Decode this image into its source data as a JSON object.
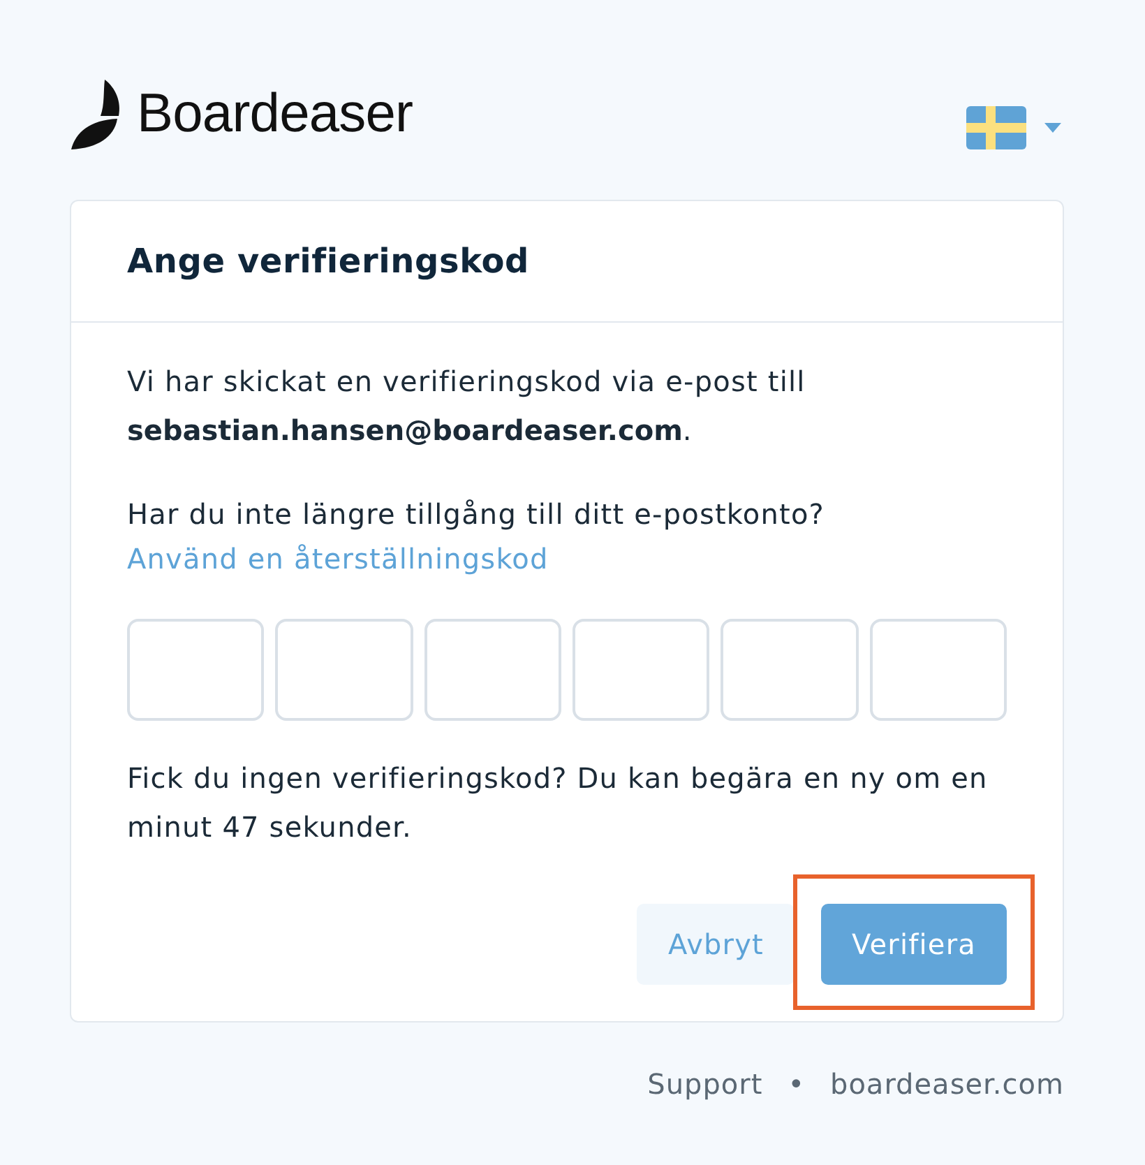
{
  "header": {
    "logo_text": "Boardeaser"
  },
  "card": {
    "title": "Ange verifieringskod",
    "message": "Vi har skickat en verifieringskod via e-post till **sebastian.hansen@boardeaser.com**.",
    "question": "Har du inte längre tillgång till ditt e-postkonto?",
    "recovery_link": "Använd en återställningskod",
    "code_fields": [
      {
        "focused": false
      },
      {
        "focused": false
      },
      {
        "focused": false
      },
      {
        "focused": false
      },
      {
        "focused": false
      },
      {
        "focused": false
      }
    ],
    "resend_notice": "Fick du ingen verifieringskod? Du kan begära en ny om en minut 47 sekunder.",
    "buttons": [
      {
        "label": "Avbryt",
        "kind": "secondary",
        "highlighted": false
      },
      {
        "label": "Verifiera",
        "kind": "primary",
        "highlighted": true
      }
    ]
  },
  "footer": {
    "links": [
      "Support",
      "boardeaser.com"
    ],
    "separator": "•"
  }
}
